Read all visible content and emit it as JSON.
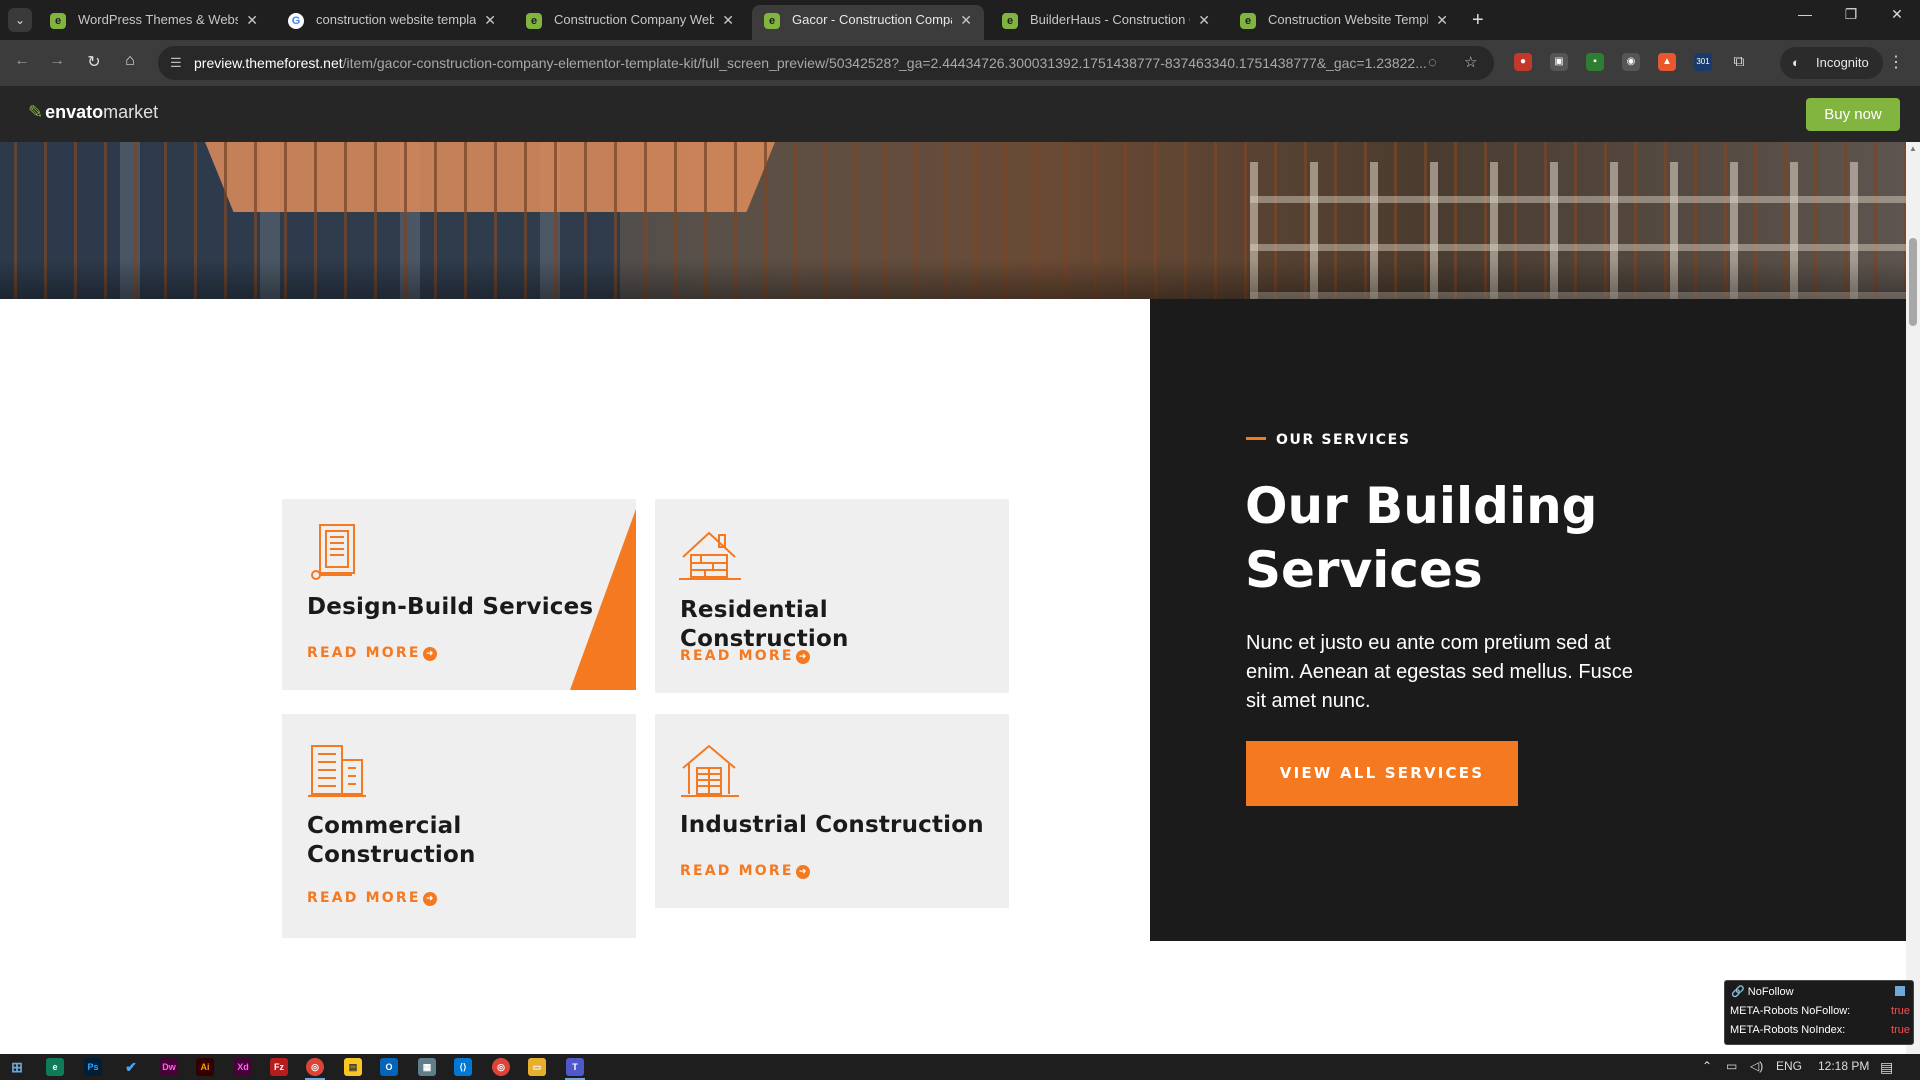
{
  "browser": {
    "tabs": [
      {
        "title": "WordPress Themes & Website T",
        "icon": "envato-leaf-icon",
        "active": false
      },
      {
        "title": "construction website template",
        "icon": "google-icon",
        "active": false
      },
      {
        "title": "Construction Company Website",
        "icon": "envato-leaf-icon",
        "active": false
      },
      {
        "title": "Gacor - Construction Company",
        "icon": "envato-leaf-icon",
        "active": true
      },
      {
        "title": "BuilderHaus - Construction Cor",
        "icon": "envato-leaf-icon",
        "active": false
      },
      {
        "title": "Construction Website Template:",
        "icon": "envato-leaf-icon",
        "active": false
      }
    ],
    "url_host": "preview.themeforest.net",
    "url_path": "/item/gacor-construction-company-elementor-template-kit/full_screen_preview/50342528?_ga=2.44434726.300031392.1751438777-837463340.1751438777&_gac=1.23822...",
    "incognito_label": "Incognito",
    "ext_badge": "301"
  },
  "envato": {
    "logo_bold": "envato",
    "logo_light": "market",
    "buy_now": "Buy now"
  },
  "services": {
    "cards": [
      {
        "title": "Design-Build Services",
        "more": "READ MORE",
        "icon": "building-plan-icon"
      },
      {
        "title": "Residential Construction",
        "more": "READ MORE",
        "icon": "house-brick-icon"
      },
      {
        "title": "Commercial Construction",
        "more": "READ MORE",
        "icon": "office-building-icon"
      },
      {
        "title": "Industrial Construction",
        "more": "READ MORE",
        "icon": "warehouse-icon"
      }
    ],
    "kicker": "OUR SERVICES",
    "heading": "Our Building Services",
    "lead": "Nunc et justo eu ante com pretium sed at enim. Aenean at egestas sed mellus. Fusce sit amet nunc.",
    "cta": "VIEW ALL SERVICES",
    "accent": "#f47920",
    "panel_bg": "#1c1b1b"
  },
  "nofollow_popup": {
    "title": "NoFollow",
    "rows": [
      {
        "label": "META-Robots NoFollow:",
        "value": "true"
      },
      {
        "label": "META-Robots NoIndex:",
        "value": "true"
      }
    ]
  },
  "taskbar": {
    "lang": "ENG",
    "time": "12:18 PM"
  }
}
